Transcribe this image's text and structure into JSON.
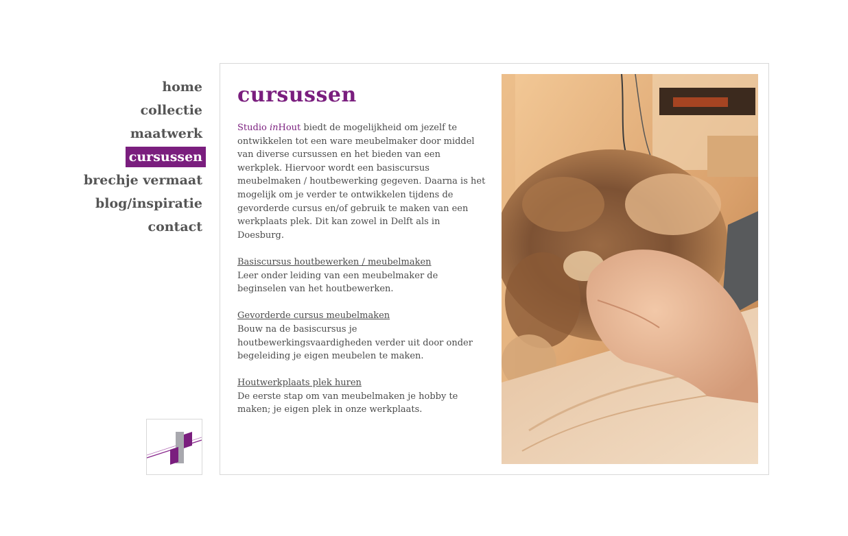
{
  "nav": {
    "items": [
      {
        "label": "home"
      },
      {
        "label": "collectie"
      },
      {
        "label": "maatwerk"
      },
      {
        "label": "cursussen",
        "active": true
      },
      {
        "label": "brechje vermaat"
      },
      {
        "label": "blog/inspiratie"
      },
      {
        "label": "contact"
      }
    ]
  },
  "page": {
    "title": "cursussen",
    "intro": {
      "brand_prefix": "Studio ",
      "brand_italic": "in",
      "brand_suffix": "Hout",
      "text": " biedt de mogelijkheid om jezelf te ontwikkelen tot een ware meubelmaker door middel van diverse cursussen en het bieden van een werkplek. Hiervoor wordt een basiscursus meubelmaken / houtbewerking gegeven. Daarna is het mogelijk om je verder te ontwikkelen tijdens de gevorderde cursus en/of gebruik te maken van een werkplaats plek. Dit kan zowel in Delft als in Doesburg."
    },
    "sections": [
      {
        "title": "Basiscursus houtbewerken / meubelmaken",
        "text": "Leer onder leiding van een meubelmaker de beginselen van het houtbewerken."
      },
      {
        "title": "Gevorderde cursus meubelmaken",
        "text": "Bouw na de basiscursus je houtbewerkingsvaardigheden verder uit door onder begeleiding je eigen meubelen te maken."
      },
      {
        "title": "Houtwerkplaats plek huren",
        "text": "De eerste stap om van meubelmaken je hobby te maken; je eigen plek in onze werkplaats."
      }
    ]
  },
  "colors": {
    "accent": "#7a1e7e",
    "nav_text": "#555555",
    "body_text": "#4a4a4a",
    "border": "#d8d8d8"
  },
  "icons": {
    "logo": "studio-inhout-logo"
  }
}
